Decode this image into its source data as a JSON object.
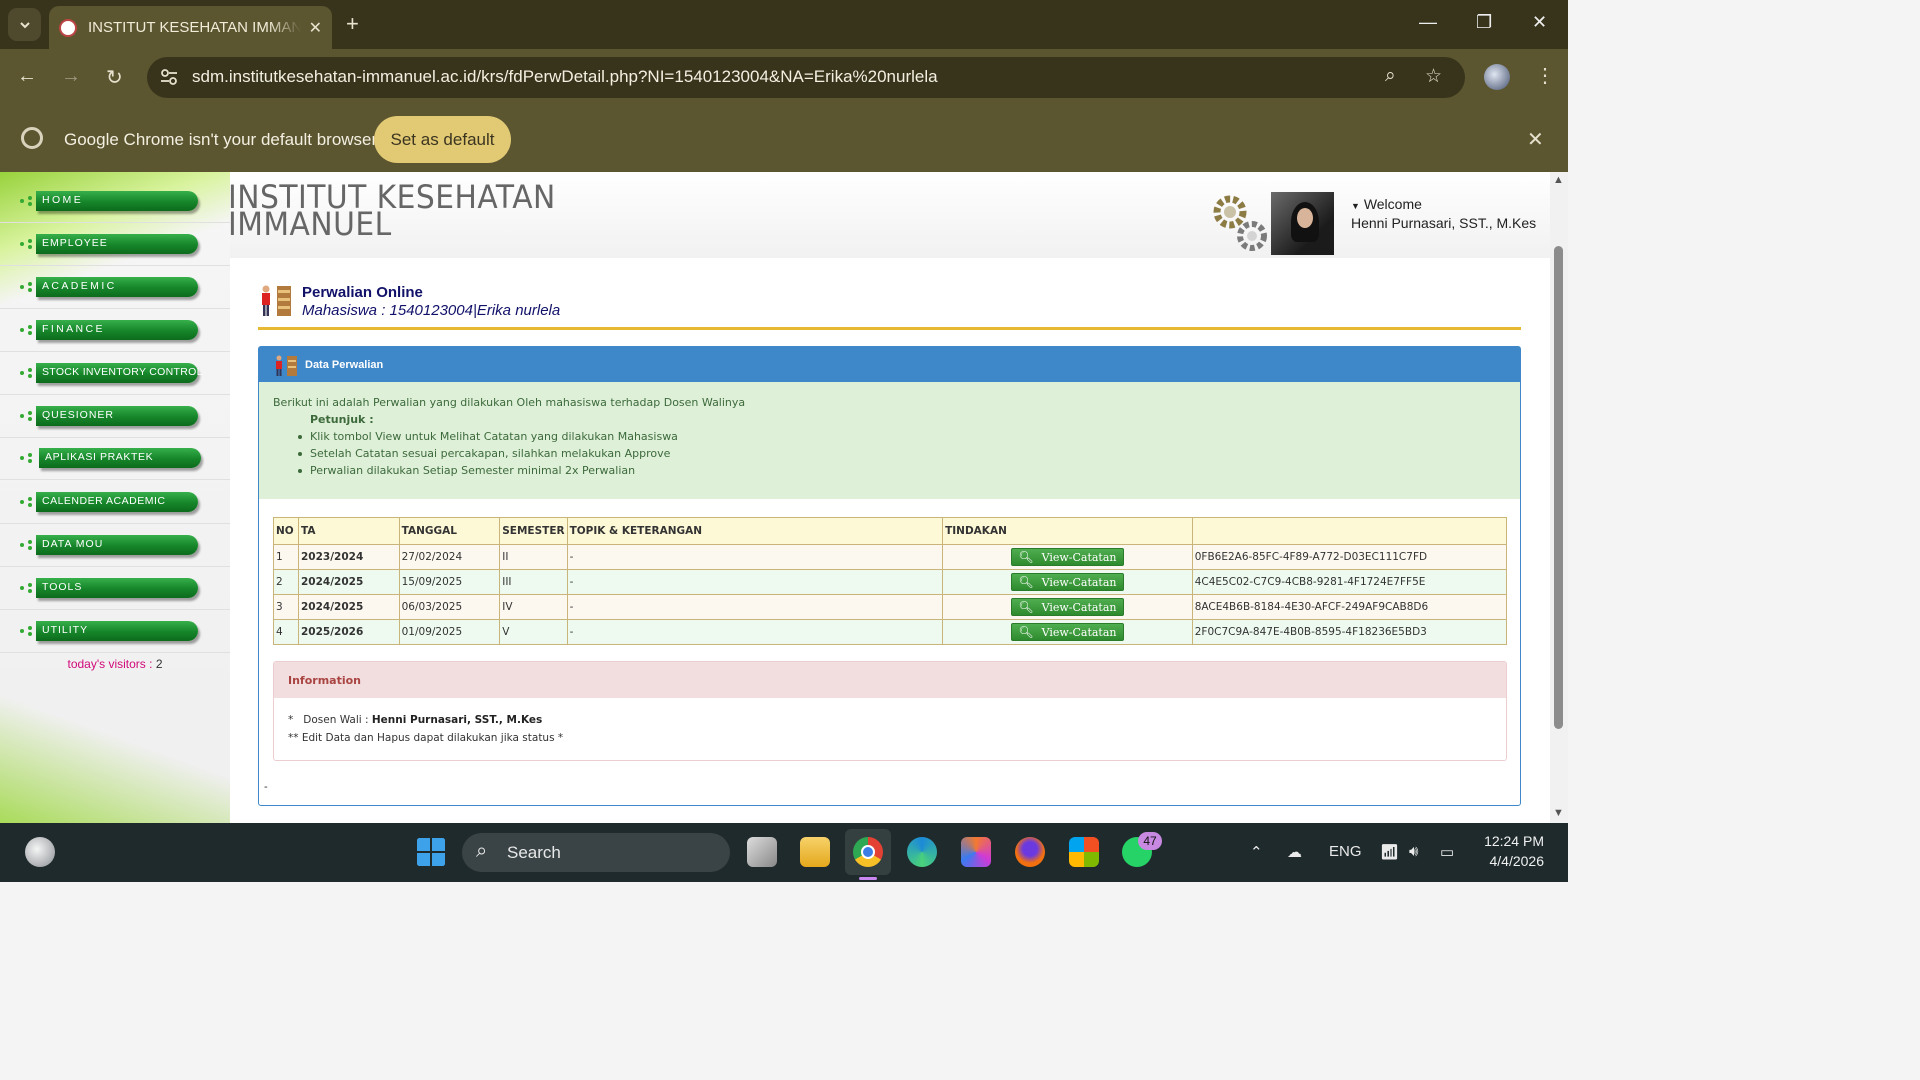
{
  "browser": {
    "tab_title": "INSTITUT KESEHATAN IMMANUEL",
    "url": "sdm.institutkesehatan-immanuel.ac.id/krs/fdPerwDetail.php?NI=1540123004&NA=Erika%20nurlela",
    "infobar_message": "Google Chrome isn't your default browser",
    "infobar_button": "Set as default"
  },
  "sidebar": {
    "items": [
      {
        "label": "HOME"
      },
      {
        "label": "EMPLOYEE"
      },
      {
        "label": "ACADEMIC"
      },
      {
        "label": "FINANCE"
      },
      {
        "label": "STOCK INVENTORY CONTROL"
      },
      {
        "label": "QUESIONER"
      },
      {
        "label": "APLIKASI PRAKTEK"
      },
      {
        "label": "CALENDER ACADEMIC"
      },
      {
        "label": "DATA MOU"
      },
      {
        "label": "TOOLS"
      },
      {
        "label": "UTILITY"
      }
    ],
    "visitors_label": "today's visitors :",
    "visitors_count": "2"
  },
  "header": {
    "site_line1": "INSTITUT KESEHATAN",
    "site_line2": "IMMANUEL",
    "welcome": "Welcome",
    "user_name": "Henni Purnasari, SST., M.Kes"
  },
  "page": {
    "title": "Perwalian Online",
    "subtitle": "Mahasiswa : 1540123004|Erika nurlela",
    "panel_title": "Data Perwalian",
    "intro": "Berikut ini adalah Perwalian yang dilakukan Oleh mahasiswa terhadap Dosen Walinya",
    "hint_label": "Petunjuk :",
    "hints": [
      "Klik tombol View untuk Melihat Catatan yang dilakukan Mahasiswa",
      "Setelah Catatan sesuai percakapan, silahkan melakukan Approve",
      "Perwalian dilakukan Setiap Semester minimal 2x Perwalian"
    ],
    "table": {
      "headers": [
        "NO",
        "TA",
        "TANGGAL",
        "SEMESTER",
        "TOPIK & KETERANGAN",
        "TINDAKAN",
        ""
      ],
      "button_label": "View-Catatan",
      "rows": [
        {
          "no": "1",
          "ta": "2023/2024",
          "tanggal": "27/02/2024",
          "semester": "II",
          "topik": "-",
          "id": "0FB6E2A6-85FC-4F89-A772-D03EC111C7FD"
        },
        {
          "no": "2",
          "ta": "2024/2025",
          "tanggal": "15/09/2025",
          "semester": "III",
          "topik": "-",
          "id": "4C4E5C02-C7C9-4CB8-9281-4F1724E7FF5E"
        },
        {
          "no": "3",
          "ta": "2024/2025",
          "tanggal": "06/03/2025",
          "semester": "IV",
          "topik": "-",
          "id": "8ACE4B6B-8184-4E30-AFCF-249AF9CAB8D6"
        },
        {
          "no": "4",
          "ta": "2025/2026",
          "tanggal": "01/09/2025",
          "semester": "V",
          "topik": "-",
          "id": "2F0C7C9A-847E-4B0B-8595-4F18236E5BD3"
        }
      ]
    },
    "info_title": "Information",
    "info_line1_prefix": "*   Dosen Wali : ",
    "info_line1_name": "Henni Purnasari, SST., M.Kes",
    "info_line2": "** Edit Data dan Hapus dapat dilakukan jika status *",
    "footer_dash": "-"
  },
  "taskbar": {
    "search": "Search",
    "whatsapp_badge": "47",
    "lang": "ENG",
    "time": "12:24 PM",
    "date": "4/4/2026"
  },
  "colors": {
    "accent_blue": "#3e87c8",
    "menu_green": "#16852a",
    "gold_rule": "#e7b831"
  }
}
